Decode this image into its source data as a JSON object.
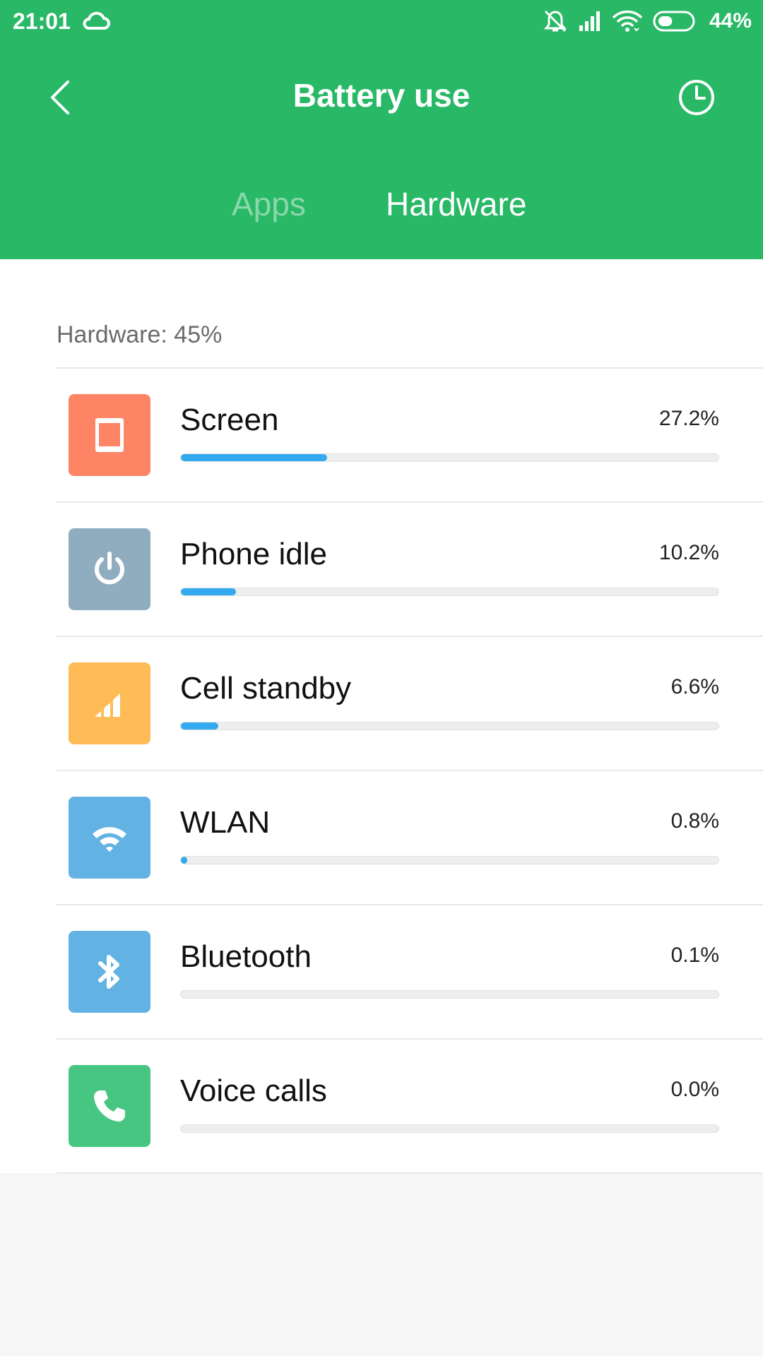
{
  "status_bar": {
    "time": "21:01",
    "battery_percent": "44%",
    "battery_level": 0.44,
    "icons": [
      "cloud-icon",
      "vibrate-mute-icon",
      "signal-icon",
      "wifi-icon",
      "battery-icon"
    ]
  },
  "header": {
    "title": "Battery use",
    "back_icon": "chevron-left-icon",
    "history_icon": "clock-icon"
  },
  "tabs": [
    {
      "label": "Apps",
      "active": false
    },
    {
      "label": "Hardware",
      "active": true
    }
  ],
  "section": {
    "title": "Hardware: 45%"
  },
  "items": [
    {
      "label": "Screen",
      "percent": "27.2%",
      "bar_fraction": 0.272,
      "icon": "screen-icon",
      "color": "#fe8466"
    },
    {
      "label": "Phone idle",
      "percent": "10.2%",
      "bar_fraction": 0.102,
      "icon": "power-icon",
      "color": "#90acbf"
    },
    {
      "label": "Cell standby",
      "percent": "6.6%",
      "bar_fraction": 0.07,
      "icon": "cell-signal-icon",
      "color": "#ffbb55"
    },
    {
      "label": "WLAN",
      "percent": "0.8%",
      "bar_fraction": 0.008,
      "icon": "wifi-icon",
      "color": "#62b3e3"
    },
    {
      "label": "Bluetooth",
      "percent": "0.1%",
      "bar_fraction": 0.0,
      "icon": "bluetooth-icon",
      "color": "#62b3e3"
    },
    {
      "label": "Voice calls",
      "percent": "0.0%",
      "bar_fraction": 0.0,
      "icon": "phone-icon",
      "color": "#47c682"
    }
  ],
  "colors": {
    "header_bg": "#28b866",
    "bar_fill": "#33aaf0",
    "page_bg": "#f6f6f6"
  }
}
